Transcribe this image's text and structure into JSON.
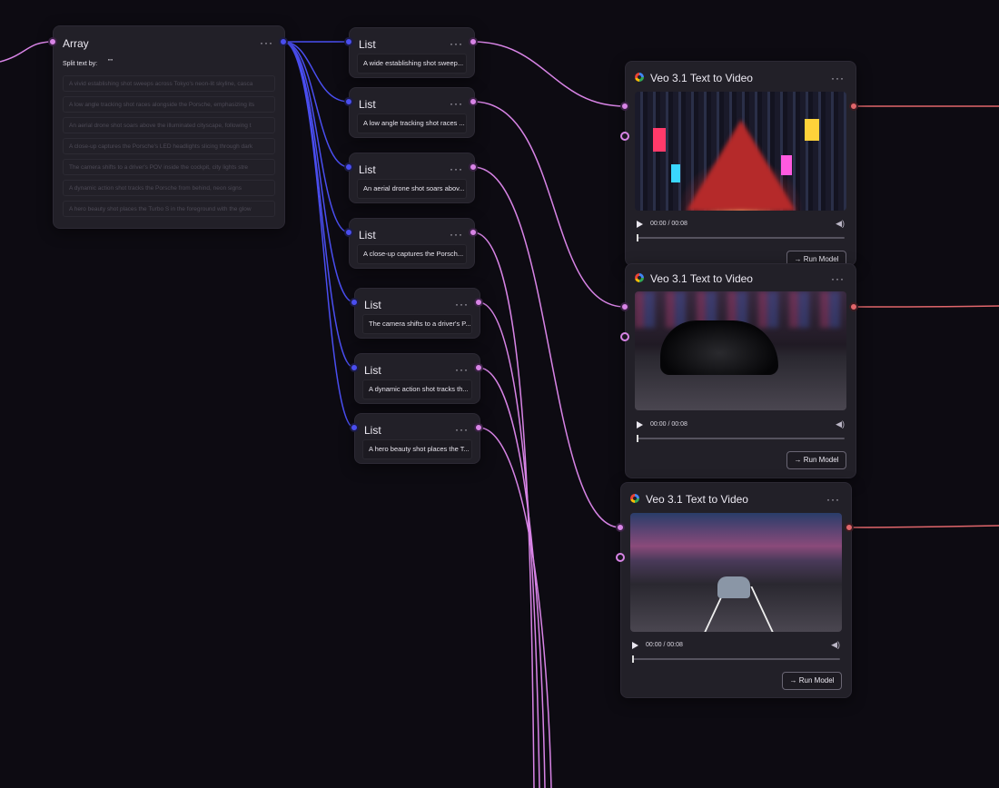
{
  "array_node": {
    "title": "Array",
    "more": "···",
    "split_label": "Split text by:",
    "split_value": "\"\"",
    "items": [
      "A vivid establishing shot sweeps across Tokyo's neon-lit skyline, casca",
      "A low angle tracking shot races alongside the Porsche, emphasizing its",
      "An aerial drone shot soars above the illuminated cityscape, following t",
      "A close-up captures the Porsche's LED headlights slicing through dark",
      "The camera shifts to a driver's POV inside the cockpit, city lights stre",
      "A dynamic action shot tracks the Porsche from behind, neon signs",
      "A hero beauty shot places the Turbo S in the foreground with the glow"
    ]
  },
  "list_nodes": [
    {
      "title": "List",
      "more": "···",
      "text": "A wide establishing shot sweep..."
    },
    {
      "title": "List",
      "more": "···",
      "text": "A low angle tracking shot races ..."
    },
    {
      "title": "List",
      "more": "···",
      "text": "An aerial drone shot soars abov..."
    },
    {
      "title": "List",
      "more": "···",
      "text": "A close-up captures the Porsch..."
    },
    {
      "title": "List",
      "more": "···",
      "text": "The camera shifts to a driver's P..."
    },
    {
      "title": "List",
      "more": "···",
      "text": "A dynamic action shot tracks th..."
    },
    {
      "title": "List",
      "more": "···",
      "text": "A hero beauty shot places the T..."
    }
  ],
  "video_nodes": [
    {
      "title": "Veo 3.1 Text to Video",
      "more": "···",
      "time": "00:00 / 00:08",
      "run_label": "→ Run Model",
      "progress": 0
    },
    {
      "title": "Veo 3.1 Text to Video",
      "more": "···",
      "time": "00:00 / 00:08",
      "run_label": "→ Run Model",
      "progress": 0
    },
    {
      "title": "Veo 3.1 Text to Video",
      "more": "···",
      "time": "00:00 / 00:08",
      "run_label": "→ Run Model",
      "progress": 0
    }
  ],
  "colors": {
    "background": "#0d0b12",
    "node": "#222028",
    "wire_blue": "#4a4ef0",
    "wire_pink": "#d884e6",
    "wire_red": "#e0666b"
  }
}
